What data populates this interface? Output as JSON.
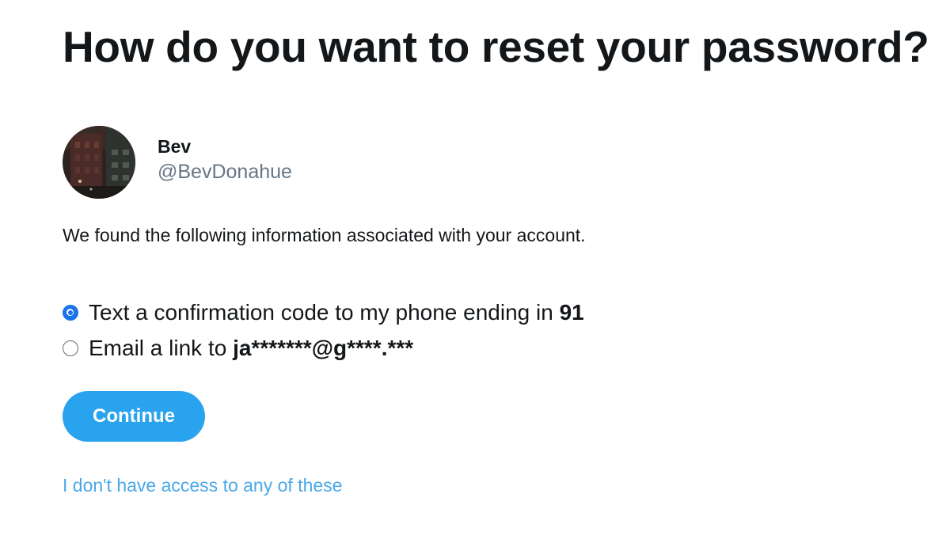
{
  "page": {
    "title": "How do you want to reset your password?"
  },
  "account": {
    "display_name": "Bev",
    "handle": "@BevDonahue",
    "avatar_icon": "profile-photo"
  },
  "info_text": "We found the following information associated with your account.",
  "options": [
    {
      "prefix": "Text a confirmation code to my phone ending in ",
      "bold": "91",
      "selected": true
    },
    {
      "prefix": "Email a link to ",
      "bold": "ja*******@g****.***",
      "selected": false
    }
  ],
  "continue_label": "Continue",
  "no_access_link": "I don't have access to any of these",
  "colors": {
    "accent": "#2aa3ef",
    "link": "#4aa8e8",
    "radio_selected": "#1a73e8",
    "text": "#14171a",
    "secondary_text": "#657786"
  }
}
